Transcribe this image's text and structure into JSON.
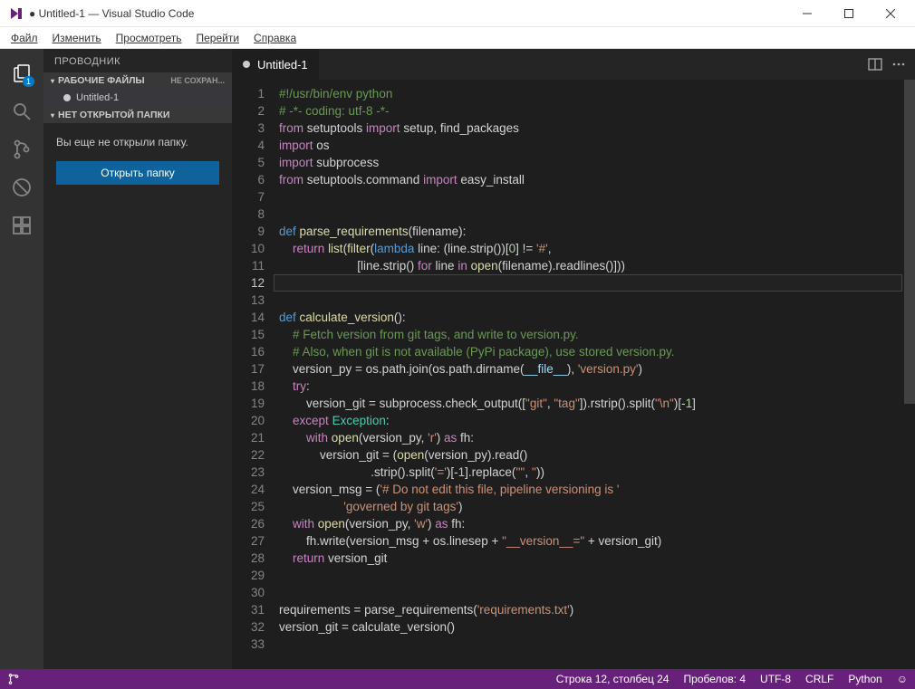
{
  "window": {
    "title": "● Untitled-1 — Visual Studio Code"
  },
  "menu": [
    "Файл",
    "Изменить",
    "Просмотреть",
    "Перейти",
    "Справка"
  ],
  "activity": {
    "items": [
      "Explorer",
      "Search",
      "SourceControl",
      "Debug",
      "Extensions"
    ],
    "badge": "1"
  },
  "sidebar": {
    "title": "ПРОВОДНИК",
    "working_files": "РАБОЧИЕ ФАЙЛЫ",
    "working_tag": "НЕ СОХРАН...",
    "open_file": "Untitled-1",
    "no_folder": "НЕТ ОТКРЫТОЙ ПАПКИ",
    "no_folder_msg": "Вы еще не открыли папку.",
    "open_folder_btn": "Открыть папку"
  },
  "tab": {
    "name": "Untitled-1"
  },
  "editor_actions": {
    "split": "split",
    "more": "more"
  },
  "code_lines": [
    [
      {
        "c": "c-comment",
        "t": "#!/usr/bin/env python"
      }
    ],
    [
      {
        "c": "c-comment",
        "t": "# -*- coding: utf-8 -*-"
      }
    ],
    [
      {
        "c": "c-key",
        "t": "from"
      },
      {
        "c": "",
        "t": " setuptools "
      },
      {
        "c": "c-key",
        "t": "import"
      },
      {
        "c": "",
        "t": " setup, find_packages"
      }
    ],
    [
      {
        "c": "c-key",
        "t": "import"
      },
      {
        "c": "",
        "t": " os"
      }
    ],
    [
      {
        "c": "c-key",
        "t": "import"
      },
      {
        "c": "",
        "t": " subprocess"
      }
    ],
    [
      {
        "c": "c-key",
        "t": "from"
      },
      {
        "c": "",
        "t": " setuptools.command "
      },
      {
        "c": "c-key",
        "t": "import"
      },
      {
        "c": "",
        "t": " easy_install"
      }
    ],
    [
      {
        "c": "",
        "t": ""
      }
    ],
    [
      {
        "c": "",
        "t": ""
      }
    ],
    [
      {
        "c": "c-type",
        "t": "def "
      },
      {
        "c": "c-func",
        "t": "parse_requirements"
      },
      {
        "c": "",
        "t": "(filename):"
      }
    ],
    [
      {
        "c": "",
        "t": "    "
      },
      {
        "c": "c-key",
        "t": "return"
      },
      {
        "c": "",
        "t": " "
      },
      {
        "c": "c-func",
        "t": "list"
      },
      {
        "c": "",
        "t": "("
      },
      {
        "c": "c-func",
        "t": "filter"
      },
      {
        "c": "",
        "t": "("
      },
      {
        "c": "c-type",
        "t": "lambda"
      },
      {
        "c": "",
        "t": " line: (line.strip())["
      },
      {
        "c": "c-num",
        "t": "0"
      },
      {
        "c": "",
        "t": "] != "
      },
      {
        "c": "c-str",
        "t": "'#'"
      },
      {
        "c": "",
        "t": ","
      }
    ],
    [
      {
        "c": "",
        "t": "                       [line.strip() "
      },
      {
        "c": "c-key",
        "t": "for"
      },
      {
        "c": "",
        "t": " line "
      },
      {
        "c": "c-key",
        "t": "in"
      },
      {
        "c": "",
        "t": " "
      },
      {
        "c": "c-func",
        "t": "open"
      },
      {
        "c": "",
        "t": "(filename).readlines()]))"
      }
    ],
    [
      {
        "c": "",
        "t": ""
      }
    ],
    [
      {
        "c": "",
        "t": ""
      }
    ],
    [
      {
        "c": "c-type",
        "t": "def "
      },
      {
        "c": "c-func",
        "t": "calculate_version"
      },
      {
        "c": "",
        "t": "():"
      }
    ],
    [
      {
        "c": "",
        "t": "    "
      },
      {
        "c": "c-comment",
        "t": "# Fetch version from git tags, and write to version.py."
      }
    ],
    [
      {
        "c": "",
        "t": "    "
      },
      {
        "c": "c-comment",
        "t": "# Also, when git is not available (PyPi package), use stored version.py."
      }
    ],
    [
      {
        "c": "",
        "t": "    version_py = os.path.join(os.path.dirname("
      },
      {
        "c": "c-var",
        "t": "__file__"
      },
      {
        "c": "",
        "t": "), "
      },
      {
        "c": "c-str",
        "t": "'version.py'"
      },
      {
        "c": "",
        "t": ")"
      }
    ],
    [
      {
        "c": "",
        "t": "    "
      },
      {
        "c": "c-key",
        "t": "try"
      },
      {
        "c": "",
        "t": ":"
      }
    ],
    [
      {
        "c": "",
        "t": "        version_git = subprocess.check_output(["
      },
      {
        "c": "c-str",
        "t": "\"git\""
      },
      {
        "c": "",
        "t": ", "
      },
      {
        "c": "c-str",
        "t": "\"tag\""
      },
      {
        "c": "",
        "t": "]).rstrip().split("
      },
      {
        "c": "c-str",
        "t": "\"\\n\""
      },
      {
        "c": "",
        "t": ")[-"
      },
      {
        "c": "c-num",
        "t": "1"
      },
      {
        "c": "",
        "t": "]"
      }
    ],
    [
      {
        "c": "",
        "t": "    "
      },
      {
        "c": "c-key",
        "t": "except"
      },
      {
        "c": "",
        "t": " "
      },
      {
        "c": "c-mod",
        "t": "Exception"
      },
      {
        "c": "",
        "t": ":"
      }
    ],
    [
      {
        "c": "",
        "t": "        "
      },
      {
        "c": "c-key",
        "t": "with"
      },
      {
        "c": "",
        "t": " "
      },
      {
        "c": "c-func",
        "t": "open"
      },
      {
        "c": "",
        "t": "(version_py, "
      },
      {
        "c": "c-str",
        "t": "'r'"
      },
      {
        "c": "",
        "t": ") "
      },
      {
        "c": "c-key",
        "t": "as"
      },
      {
        "c": "",
        "t": " fh:"
      }
    ],
    [
      {
        "c": "",
        "t": "            version_git = ("
      },
      {
        "c": "c-func",
        "t": "open"
      },
      {
        "c": "",
        "t": "(version_py).read()"
      }
    ],
    [
      {
        "c": "",
        "t": "                           .strip().split("
      },
      {
        "c": "c-str",
        "t": "'='"
      },
      {
        "c": "",
        "t": ")[-"
      },
      {
        "c": "c-num",
        "t": "1"
      },
      {
        "c": "",
        "t": "].replace("
      },
      {
        "c": "c-str",
        "t": "'\"'"
      },
      {
        "c": "",
        "t": ", "
      },
      {
        "c": "c-str",
        "t": "''"
      },
      {
        "c": "",
        "t": "))"
      }
    ],
    [
      {
        "c": "",
        "t": "    version_msg = ("
      },
      {
        "c": "c-str",
        "t": "'# Do not edit this file, pipeline versioning is '"
      }
    ],
    [
      {
        "c": "",
        "t": "                   "
      },
      {
        "c": "c-str",
        "t": "'governed by git tags'"
      },
      {
        "c": "",
        "t": ")"
      }
    ],
    [
      {
        "c": "",
        "t": "    "
      },
      {
        "c": "c-key",
        "t": "with"
      },
      {
        "c": "",
        "t": " "
      },
      {
        "c": "c-func",
        "t": "open"
      },
      {
        "c": "",
        "t": "(version_py, "
      },
      {
        "c": "c-str",
        "t": "'w'"
      },
      {
        "c": "",
        "t": ") "
      },
      {
        "c": "c-key",
        "t": "as"
      },
      {
        "c": "",
        "t": " fh:"
      }
    ],
    [
      {
        "c": "",
        "t": "        fh.write(version_msg + os.linesep + "
      },
      {
        "c": "c-str",
        "t": "\"__version__=\""
      },
      {
        "c": "",
        "t": " + version_git)"
      }
    ],
    [
      {
        "c": "",
        "t": "    "
      },
      {
        "c": "c-key",
        "t": "return"
      },
      {
        "c": "",
        "t": " version_git"
      }
    ],
    [
      {
        "c": "",
        "t": ""
      }
    ],
    [
      {
        "c": "",
        "t": ""
      }
    ],
    [
      {
        "c": "",
        "t": "requirements = parse_requirements("
      },
      {
        "c": "c-str",
        "t": "'requirements.txt'"
      },
      {
        "c": "",
        "t": ")"
      }
    ],
    [
      {
        "c": "",
        "t": "version_git = calculate_version()"
      }
    ],
    [
      {
        "c": "",
        "t": ""
      }
    ]
  ],
  "cursor_line": 12,
  "status": {
    "position": "Строка 12, столбец 24",
    "indent": "Пробелов: 4",
    "encoding": "UTF-8",
    "eol": "CRLF",
    "language": "Python",
    "feedback": "☺"
  }
}
